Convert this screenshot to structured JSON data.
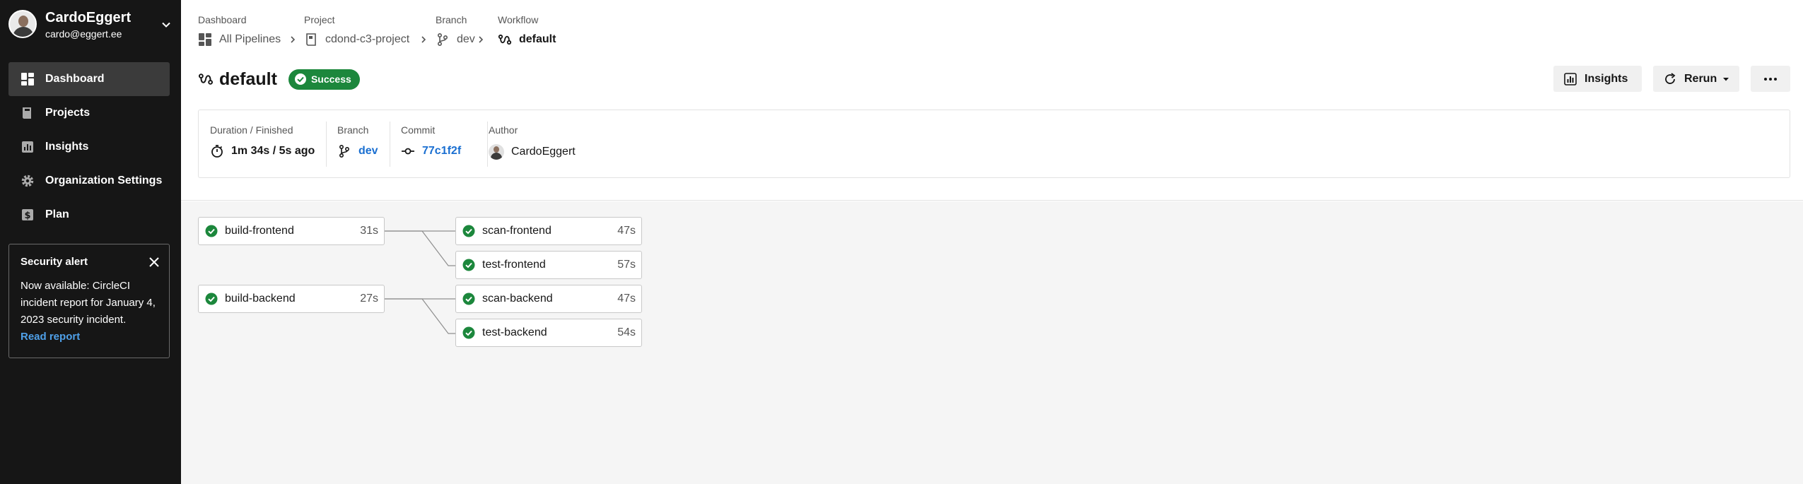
{
  "user": {
    "name": "CardoEggert",
    "email": "cardo@eggert.ee"
  },
  "sidebar": {
    "items": [
      {
        "label": "Dashboard",
        "icon": "dashboard-icon",
        "active": true
      },
      {
        "label": "Projects",
        "icon": "book-icon",
        "active": false
      },
      {
        "label": "Insights",
        "icon": "bar-chart-icon",
        "active": false
      },
      {
        "label": "Organization Settings",
        "icon": "gear-icon",
        "active": false
      },
      {
        "label": "Plan",
        "icon": "dollar-icon",
        "active": false
      }
    ]
  },
  "alert": {
    "title": "Security alert",
    "text": "Now available: CircleCI incident report for January 4, 2023 security incident.",
    "link": "Read report"
  },
  "breadcrumb": {
    "dashboard": {
      "label": "Dashboard",
      "value": "All Pipelines"
    },
    "project": {
      "label": "Project",
      "value": "cdond-c3-project"
    },
    "branch": {
      "label": "Branch",
      "value": "dev"
    },
    "workflow": {
      "label": "Workflow",
      "value": "default"
    }
  },
  "header": {
    "title": "default",
    "status": "Success",
    "insights_label": "Insights",
    "rerun_label": "Rerun"
  },
  "info": {
    "duration": {
      "label": "Duration / Finished",
      "value": "1m 34s / 5s ago"
    },
    "branch": {
      "label": "Branch",
      "value": "dev"
    },
    "commit": {
      "label": "Commit",
      "value": "77c1f2f"
    },
    "author": {
      "label": "Author",
      "value": "CardoEggert"
    }
  },
  "jobs": [
    {
      "name": "build-frontend",
      "duration": "31s",
      "status": "success"
    },
    {
      "name": "build-backend",
      "duration": "27s",
      "status": "success"
    },
    {
      "name": "scan-frontend",
      "duration": "47s",
      "status": "success"
    },
    {
      "name": "test-frontend",
      "duration": "57s",
      "status": "success"
    },
    {
      "name": "scan-backend",
      "duration": "47s",
      "status": "success"
    },
    {
      "name": "test-backend",
      "duration": "54s",
      "status": "success"
    }
  ],
  "colors": {
    "success": "#1c873c",
    "link": "#1a6fd1",
    "sidebar_bg": "#161616"
  }
}
